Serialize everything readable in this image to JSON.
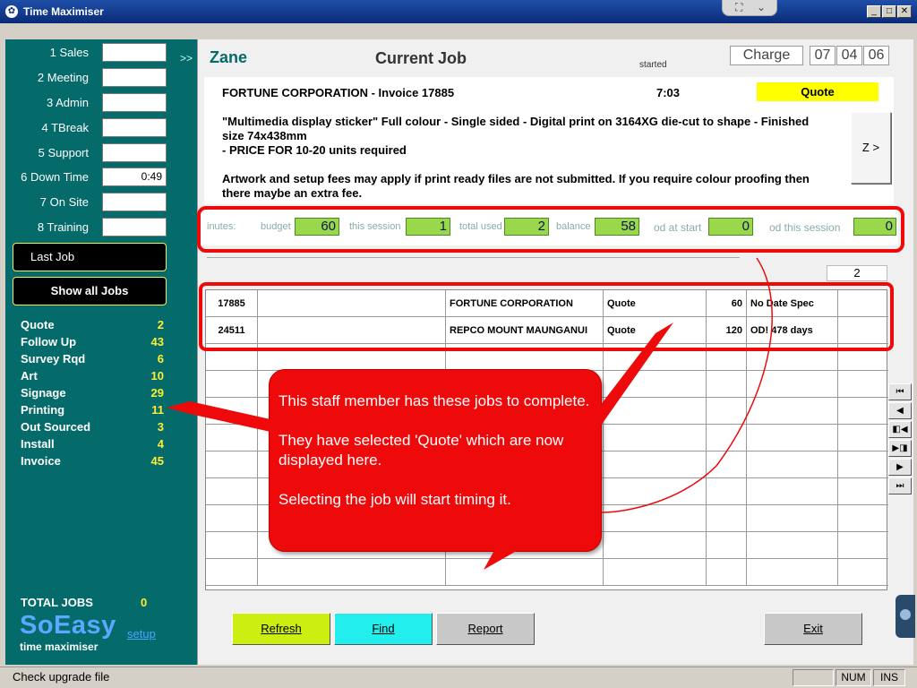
{
  "window": {
    "title": "Time Maximiser"
  },
  "sidebar": {
    "arrows": ">>",
    "time_categories": [
      {
        "label": "1 Sales",
        "value": ""
      },
      {
        "label": "2 Meeting",
        "value": ""
      },
      {
        "label": "3 Admin",
        "value": ""
      },
      {
        "label": "4 TBreak",
        "value": ""
      },
      {
        "label": "5 Support",
        "value": ""
      },
      {
        "label": "6 Down Time",
        "value": "0:49"
      },
      {
        "label": "7 On Site",
        "value": ""
      },
      {
        "label": "8 Training",
        "value": ""
      }
    ],
    "last_job_label": "Last Job",
    "show_all_jobs_label": "Show all Jobs",
    "job_statuses": [
      {
        "name": "Quote",
        "count": "2"
      },
      {
        "name": "Follow Up",
        "count": "43"
      },
      {
        "name": "Survey Rqd",
        "count": "6"
      },
      {
        "name": "Art",
        "count": "10"
      },
      {
        "name": "Signage",
        "count": "29"
      },
      {
        "name": "Printing",
        "count": "11"
      },
      {
        "name": "Out Sourced",
        "count": "3"
      },
      {
        "name": "Install",
        "count": "4"
      },
      {
        "name": "Invoice",
        "count": "45"
      }
    ],
    "total_jobs_label": "TOTAL JOBS",
    "total_jobs_value": "0",
    "logo_text": "SoEasy",
    "logo_subtitle": "time maximiser",
    "setup_label": "setup"
  },
  "header": {
    "user_name": "Zane",
    "title": "Current Job",
    "started_label": "started",
    "charge_label": "Charge",
    "date": {
      "day": "07",
      "month": "04",
      "year": "06"
    }
  },
  "job": {
    "title": "FORTUNE CORPORATION - Invoice 17885",
    "time": "7:03",
    "status": "Quote",
    "description": "\"Multimedia display sticker\" Full colour - Single sided - Digital print on 3164XG die-cut to shape - Finished size 74x438mm\n- PRICE FOR 10-20 units required\n\nArtwork and setup fees may apply if print ready files are not submitted. If you require colour proofing then there maybe an extra fee.",
    "next_label": "Z >"
  },
  "minutes": {
    "prefix": "inutes:",
    "budget_label": "budget",
    "budget": "60",
    "session_label": "this session",
    "session": "1",
    "total_used_label": "total used",
    "total_used": "2",
    "balance_label": "balance",
    "balance": "58",
    "od_start_label": "od at start",
    "od_start": "0",
    "od_session_label": "od this session",
    "od_session": "0"
  },
  "job_list": {
    "count": "2",
    "rows": [
      {
        "number": "17885",
        "blank": "",
        "client": "FORTUNE CORPORATION",
        "status": "Quote",
        "minutes": "60",
        "due": "No Date Spec"
      },
      {
        "number": "24511",
        "blank": "",
        "client": "REPCO MOUNT MAUNGANUI",
        "status": "Quote",
        "minutes": "120",
        "due": "OD! 478 days"
      }
    ]
  },
  "buttons": {
    "refresh": "Refresh",
    "find": "Find",
    "report": "Report",
    "exit": "Exit"
  },
  "nav": {
    "first": "⏮",
    "prev": "◀",
    "new_before": "◧◀",
    "new_after": "▶◨",
    "next": "▶",
    "last": "⏭"
  },
  "annotation": {
    "text": "This staff member has these jobs to complete.\n\nThey have selected 'Quote' which are now displayed here.\n\nSelecting the job will start timing it."
  },
  "statusbar": {
    "message": "Check upgrade file",
    "num": "NUM",
    "ins": "INS"
  },
  "colors": {
    "sidebar": "#046a6a",
    "accent_yellow": "#ffee33",
    "annotation_red": "#ee0a0a",
    "minutes_green": "#98d84a"
  }
}
